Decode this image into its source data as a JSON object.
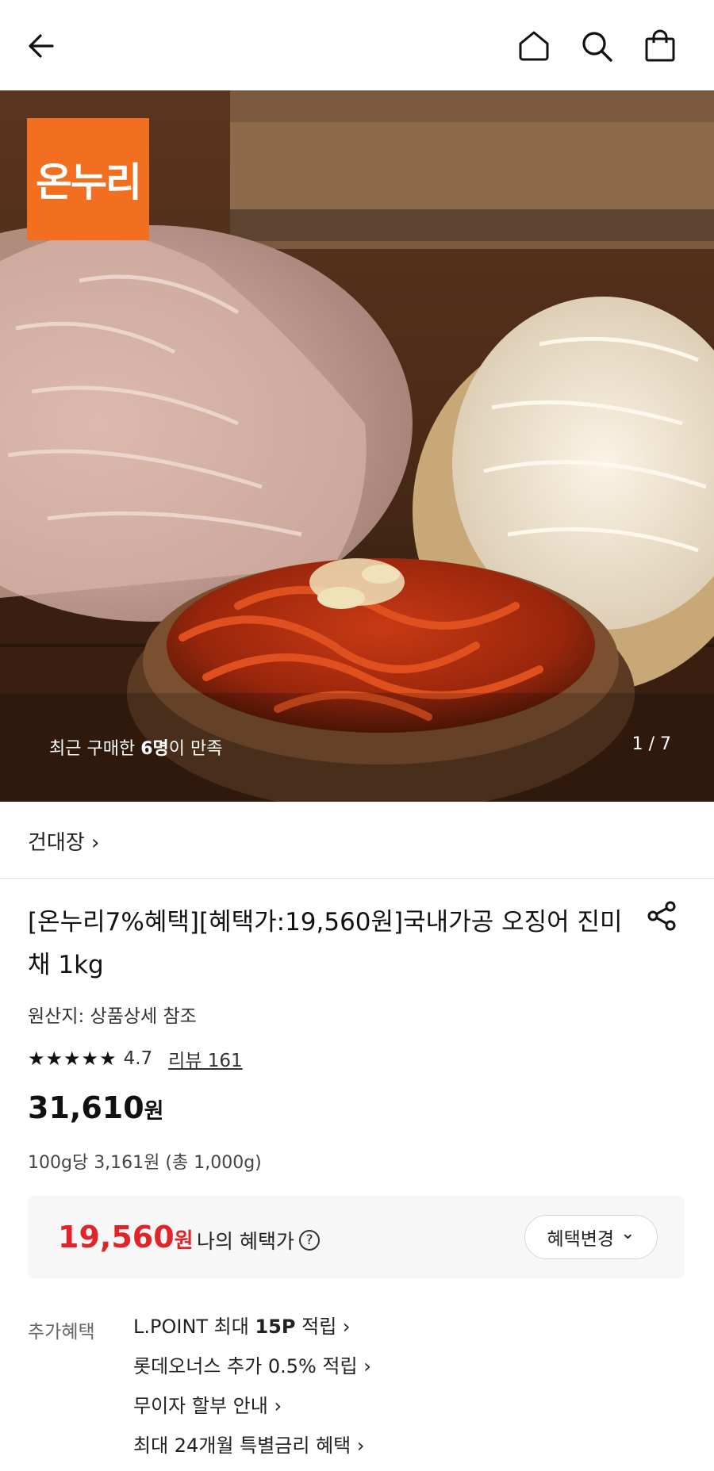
{
  "category": "건대장 ›",
  "hero": {
    "logo_text": "온누리",
    "caption_prefix": "최근 구매한 ",
    "caption_count": "6명",
    "caption_suffix": "이 만족",
    "counter": "1 / 7"
  },
  "product": {
    "title": "[온누리7%혜택][혜택가:19,560원]국내가공 오징어 진미채 1kg",
    "origin": "원산지: 상품상세 참조",
    "stars": "★★★★★",
    "rating": "4.7",
    "review": "리뷰 161",
    "price": "31,610",
    "price_unit": "원",
    "unit_price": "100g당 3,161원 (총 1,000g)"
  },
  "benefit": {
    "price": "19,560",
    "unit": "원",
    "label": "나의 혜택가",
    "help": "?",
    "change_label": "혜택변경",
    "change_chevron": "⌄"
  },
  "extra": {
    "label": "추가혜택",
    "item1_pre": "L.POINT 최대 ",
    "item1_bold": "15P",
    "item1_post": " 적립 ›",
    "item2": "롯데오너스 추가 0.5% 적립 ›",
    "item3": "무이자 할부 안내 ›",
    "item4": "최대 24개월 특별금리 혜택 ›"
  },
  "icons": [
    "back-arrow-icon",
    "home-icon",
    "search-icon",
    "shopping-bag-icon",
    "share-icon"
  ]
}
